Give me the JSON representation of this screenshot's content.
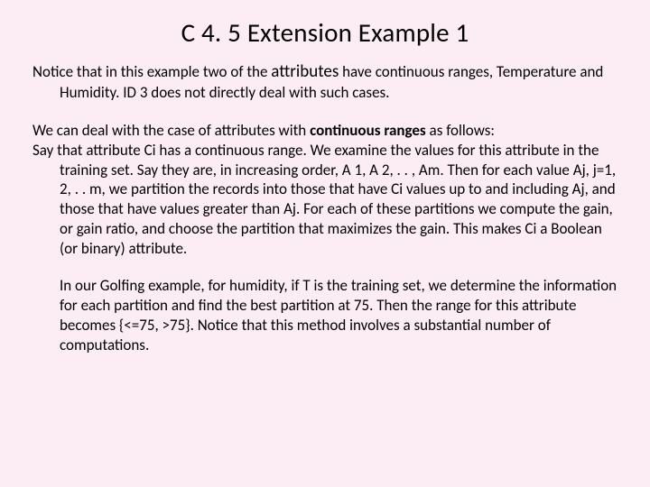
{
  "title": "C 4. 5 Extension Example 1",
  "p1_a": "Notice that in this example two of the ",
  "p1_attr": "attributes",
  "p1_b": " have continuous ranges, Temperature and Humidity. ID 3 does not directly deal with such cases.",
  "p2_a": "We can deal with the case of attributes with ",
  "p2_bold": "continuous ranges",
  "p2_b": " as follows:",
  "p3": "Say that attribute Ci has a continuous range. We examine the values for this attribute in the training set. Say they are, in increasing order, A 1, A 2, . . , Am. Then for each value Aj, j=1, 2, . . m, we partition the records into those that have Ci values up to and including Aj, and those that have values greater than Aj. For each of these partitions we compute the gain, or gain ratio, and choose the partition that maximizes the gain.  This makes Ci a Boolean (or binary) attribute.",
  "p4": "In our Golfing example, for humidity, if T is the training set, we determine the information for each partition and find the best partition at 75. Then the range for this attribute becomes {<=75, >75}. Notice that this method involves a substantial number of computations."
}
